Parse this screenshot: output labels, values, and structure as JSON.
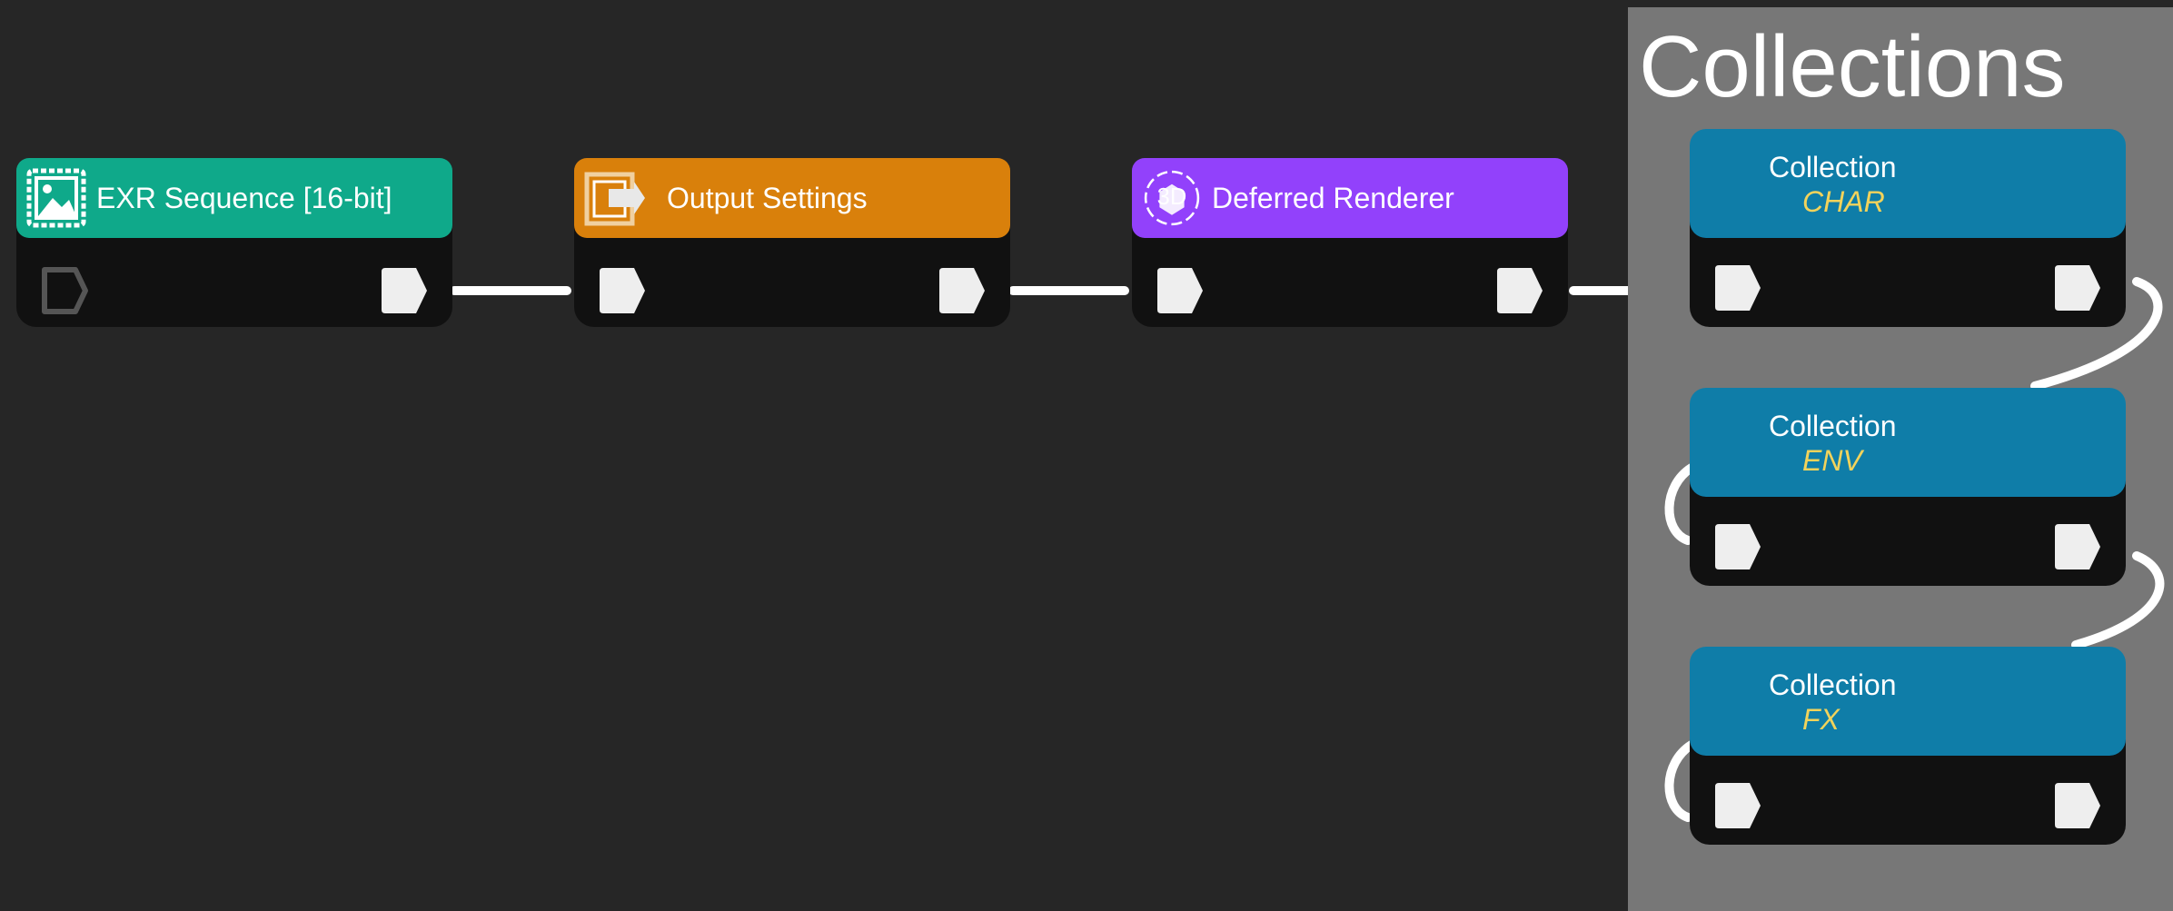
{
  "colors": {
    "canvas": "#262626",
    "node_body": "#111111",
    "port": "#eeeeee",
    "wire": "#ffffff",
    "collections_panel": "#777777",
    "collection_header": "#0f7da8",
    "collection_name": "#f2d35b"
  },
  "nodes": [
    {
      "id": "exr",
      "title": "EXR Sequence [16-bit]",
      "icon": "image-icon",
      "color": "#0fa98a",
      "input_port": "outlined"
    },
    {
      "id": "output",
      "title": "Output Settings",
      "icon": "output-arrow-icon",
      "color": "#d9800b",
      "input_port": "filled"
    },
    {
      "id": "renderer",
      "title": "Deferred Renderer",
      "icon": "3d-render-icon",
      "icon_text": "3D",
      "color": "#9241fb",
      "input_port": "filled"
    }
  ],
  "collections": {
    "title": "Collections",
    "items": [
      {
        "label": "Collection",
        "name": "CHAR"
      },
      {
        "label": "Collection",
        "name": "ENV"
      },
      {
        "label": "Collection",
        "name": "FX"
      }
    ]
  }
}
